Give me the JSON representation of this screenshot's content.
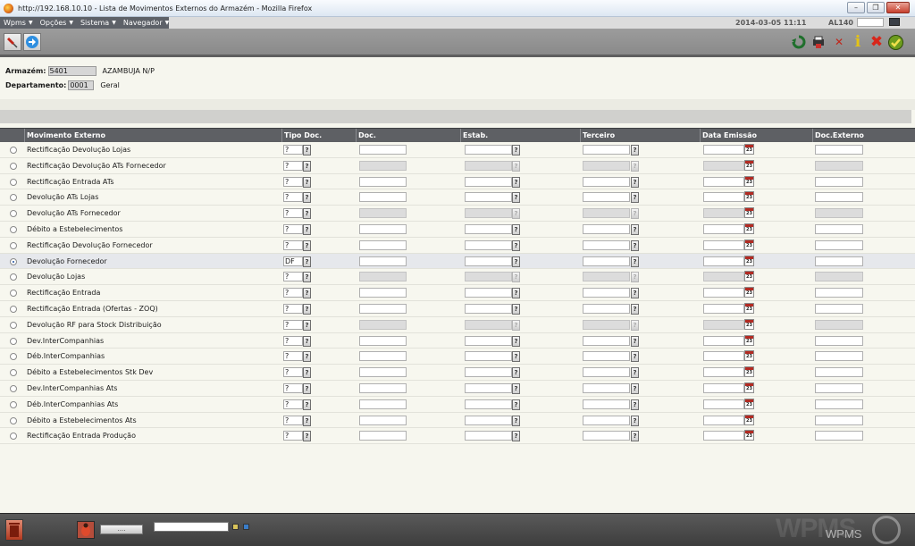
{
  "window": {
    "title": "http://192.168.10.10 - Lista de Movimentos Externos do Armazém - Mozilla Firefox"
  },
  "menu": [
    {
      "label": "Wpms"
    },
    {
      "label": "Opções"
    },
    {
      "label": "Sistema"
    },
    {
      "label": "Navegador"
    }
  ],
  "status": {
    "datetime": "2014-03-05 11:11",
    "user": "AL140"
  },
  "header": {
    "armazem_label": "Armazém:",
    "armazem_code": "5401",
    "armazem_name": "AZAMBUJA N/P",
    "departamento_label": "Departamento:",
    "departamento_code": "0001",
    "departamento_name": "Geral"
  },
  "table": {
    "columns": {
      "movimento": "Movimento Externo",
      "tipo_doc": "Tipo Doc.",
      "doc": "Doc.",
      "estab": "Estab.",
      "terceiro": "Terceiro",
      "data_emissao": "Data Emissão",
      "doc_externo": "Doc.Externo"
    },
    "rows": [
      {
        "name": "Rectificação Devolução Lojas",
        "tipo": "?",
        "selected": false,
        "full": true
      },
      {
        "name": "Rectificação Devolução ATs Fornecedor",
        "tipo": "?",
        "selected": false,
        "full": false
      },
      {
        "name": "Rectificação Entrada ATs",
        "tipo": "?",
        "selected": false,
        "full": true
      },
      {
        "name": "Devolução ATs Lojas",
        "tipo": "?",
        "selected": false,
        "full": true
      },
      {
        "name": "Devolução ATs Fornecedor",
        "tipo": "?",
        "selected": false,
        "full": false
      },
      {
        "name": "Débito a Estebelecimentos",
        "tipo": "?",
        "selected": false,
        "full": true
      },
      {
        "name": "Rectificação Devolução Fornecedor",
        "tipo": "?",
        "selected": false,
        "full": true
      },
      {
        "name": "Devolução Fornecedor",
        "tipo": "DF",
        "selected": true,
        "full": true
      },
      {
        "name": "Devolução Lojas",
        "tipo": "?",
        "selected": false,
        "full": false
      },
      {
        "name": "Rectificação Entrada",
        "tipo": "?",
        "selected": false,
        "full": true
      },
      {
        "name": "Rectificação Entrada (Ofertas - ZOQ)",
        "tipo": "?",
        "selected": false,
        "full": true
      },
      {
        "name": "Devolução RF para Stock Distribuição",
        "tipo": "?",
        "selected": false,
        "full": false
      },
      {
        "name": "Dev.InterCompanhias",
        "tipo": "?",
        "selected": false,
        "full": true
      },
      {
        "name": "Déb.InterCompanhias",
        "tipo": "?",
        "selected": false,
        "full": true
      },
      {
        "name": "Débito a Estebelecimentos Stk Dev",
        "tipo": "?",
        "selected": false,
        "full": true
      },
      {
        "name": "Dev.InterCompanhias Ats",
        "tipo": "?",
        "selected": false,
        "full": true
      },
      {
        "name": "Déb.InterCompanhias Ats",
        "tipo": "?",
        "selected": false,
        "full": true
      },
      {
        "name": "Débito a Estebelecimentos Ats",
        "tipo": "?",
        "selected": false,
        "full": true
      },
      {
        "name": "Rectificação Entrada Produção",
        "tipo": "?",
        "selected": false,
        "full": true
      }
    ]
  },
  "lookup_glyph": "?",
  "footer": {
    "dots_label": "....",
    "logo_text": "WPMS"
  },
  "icons": {
    "refresh": "refresh-icon",
    "print": "print-icon",
    "collapse": "collapse-icon",
    "info": "info-icon",
    "close": "close-icon",
    "confirm": "confirm-icon"
  },
  "colors": {
    "header_bg": "#5e6064",
    "toolbar_bg": "#8f8f8f",
    "selected_row": "#e6e8ec",
    "disabled_field": "#dcdcdc"
  }
}
